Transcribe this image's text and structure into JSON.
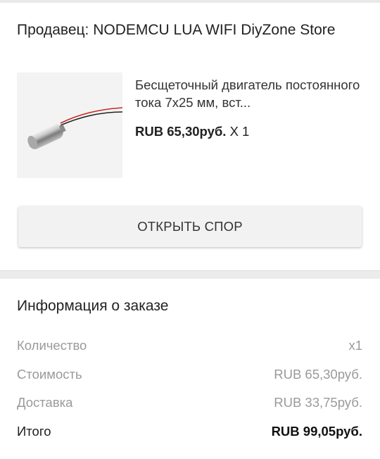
{
  "seller": {
    "label": "Продавец: NODEMCU LUA WIFI DiyZone Store"
  },
  "product": {
    "image_icon": "motor-product-image",
    "name": "Бесщеточный двигатель постоянного тока 7х25 мм, вст...",
    "price": "RUB 65,30руб.",
    "quantity": "X 1"
  },
  "dispute_button": {
    "label": "ОТКРЫТЬ СПОР"
  },
  "order_info": {
    "title": "Информация о заказе",
    "rows": [
      {
        "label": "Количество",
        "value": "x1"
      },
      {
        "label": "Стоимость",
        "value": "RUB 65,30руб."
      },
      {
        "label": "Доставка",
        "value": "RUB 33,75руб."
      },
      {
        "label": "Итого",
        "value": "RUB 99,05руб."
      }
    ]
  },
  "colors": {
    "background": "#ffffff",
    "divider": "#ececec",
    "button": "#f2f2f2",
    "muted_text": "#9a9a9a"
  }
}
